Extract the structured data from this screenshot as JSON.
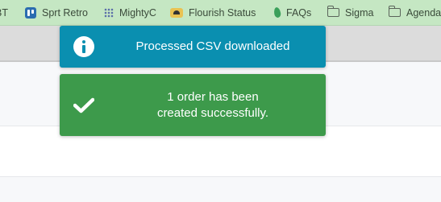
{
  "bookmarks": [
    {
      "label": "BT",
      "icon": "none"
    },
    {
      "label": "Sprt Retro",
      "icon": "trello-icon"
    },
    {
      "label": "MightyC",
      "icon": "grid-icon"
    },
    {
      "label": "Flourish Status",
      "icon": "flourish-icon"
    },
    {
      "label": "FAQs",
      "icon": "leaf-icon"
    },
    {
      "label": "Sigma",
      "icon": "folder-icon"
    },
    {
      "label": "Agenda",
      "icon": "folder-icon"
    }
  ],
  "toasts": {
    "info": {
      "message": "Processed CSV downloaded",
      "icon": "info-icon",
      "color": "#0a8fb0"
    },
    "success": {
      "message": "1 order has been created successfully.",
      "icon": "checkmark-icon",
      "color": "#3d9a4b"
    }
  },
  "colors": {
    "bookmarks_bar": "#c5e7c3",
    "header": "#dcdcdc"
  }
}
